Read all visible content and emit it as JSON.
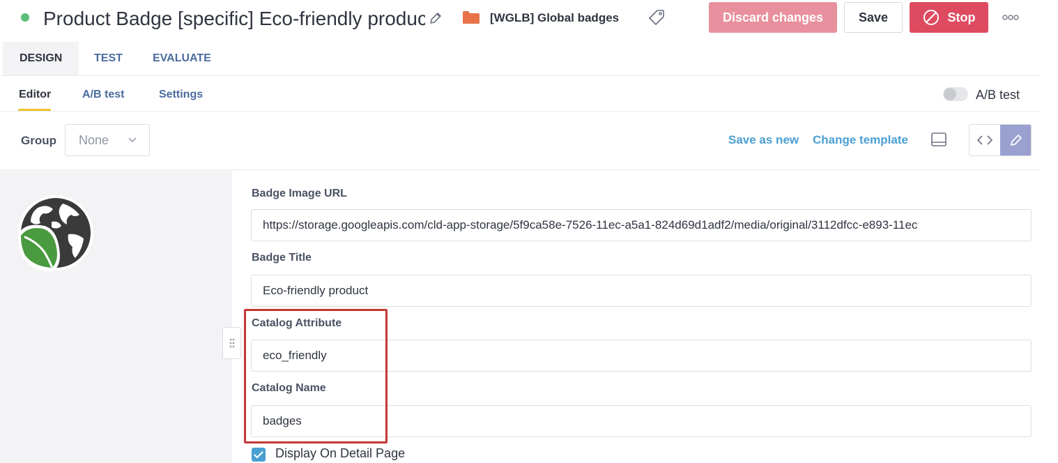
{
  "header": {
    "title": "Product Badge [specific] Eco-friendly product",
    "status": "active",
    "folder_name": "[WGLB] Global badges",
    "discard_label": "Discard changes",
    "save_label": "Save",
    "stop_label": "Stop"
  },
  "main_tabs": [
    {
      "label": "DESIGN",
      "active": true
    },
    {
      "label": "TEST",
      "active": false
    },
    {
      "label": "EVALUATE",
      "active": false
    }
  ],
  "sub_tabs": [
    {
      "label": "Editor",
      "active": true
    },
    {
      "label": "A/B test",
      "active": false
    },
    {
      "label": "Settings",
      "active": false
    }
  ],
  "ab_toggle": {
    "label": "A/B test",
    "enabled": false
  },
  "toolbar": {
    "group_label": "Group",
    "group_value": "None",
    "save_as_new_label": "Save as new",
    "change_template_label": "Change template"
  },
  "form": {
    "badge_image_url": {
      "label": "Badge Image URL",
      "value": "https://storage.googleapis.com/cld-app-storage/5f9ca58e-7526-11ec-a5a1-824d69d1adf2/media/original/3112dfcc-e893-11ec"
    },
    "badge_title": {
      "label": "Badge Title",
      "value": "Eco-friendly product"
    },
    "catalog_attribute": {
      "label": "Catalog Attribute",
      "value": "eco_friendly"
    },
    "catalog_name": {
      "label": "Catalog Name",
      "value": "badges"
    },
    "display_on_detail_page": {
      "label": "Display On Detail Page",
      "checked": true
    }
  },
  "colors": {
    "status_dot": "#5dbf7a",
    "folder": "#e8734a",
    "discard": "#e8909d",
    "stop": "#de4b60",
    "link": "#4aa0d3",
    "active_tab_underline": "#efc530",
    "highlight_box": "#c33a34",
    "edit_view_active": "#9aa0d0"
  },
  "icons": {
    "title_edit": "pencil-icon",
    "folder": "folder-icon",
    "tag": "tag-icon",
    "stop": "ban-icon",
    "more": "more-dots-icon",
    "group_dropdown": "chevron-down-icon",
    "layout": "layout-icon",
    "code_view": "code-icon",
    "edit_view": "pencil-icon",
    "drag_handle": "drag-handle-icon",
    "badge_image": "eco-globe-leaf-icon"
  }
}
